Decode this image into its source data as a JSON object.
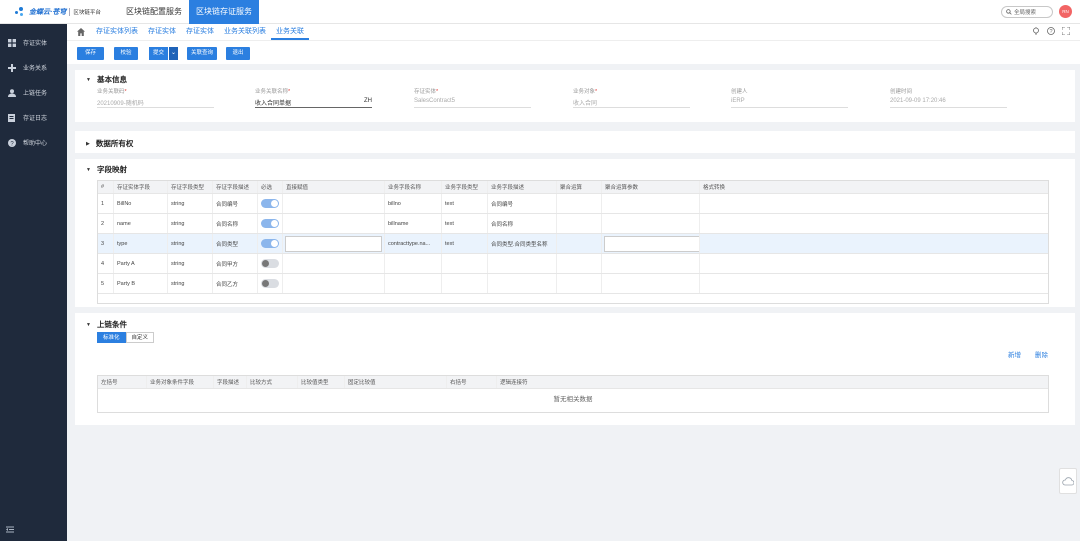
{
  "topbar": {
    "logo_text": "金蝶云·苍穹",
    "logo_platform": "区块链平台",
    "nav": [
      "区块链配置服务",
      "区块链存证服务"
    ],
    "search_placeholder": "全局搜索",
    "avatar": "RN",
    "accent": "#2b7fe0"
  },
  "sidebar": {
    "items": [
      {
        "label": "存证实体",
        "icon": "grid-icon"
      },
      {
        "label": "业务关系",
        "icon": "puzzle-icon"
      },
      {
        "label": "上链任务",
        "icon": "user-icon"
      },
      {
        "label": "存证日志",
        "icon": "doc-icon"
      },
      {
        "label": "帮助中心",
        "icon": "help-icon"
      }
    ]
  },
  "tabs": [
    "存证实体列表",
    "存证实体",
    "存证实体",
    "业务关联列表",
    "业务关联"
  ],
  "toolbar": {
    "save": "保存",
    "check": "校验",
    "submit": "提交",
    "related": "关联查询",
    "exit": "退出"
  },
  "basic": {
    "title": "基本信息",
    "fields": [
      {
        "label": "业务关联码",
        "required": true,
        "value": "20210909-随机码"
      },
      {
        "label": "业务关联名称",
        "required": true,
        "value": "收入合同单据",
        "suffix": "ZH"
      },
      {
        "label": "存证实体",
        "required": true,
        "value": "SalesContract5"
      },
      {
        "label": "业务对象",
        "required": true,
        "value": "收入合同"
      },
      {
        "label": "创建人",
        "required": false,
        "value": "iERP"
      },
      {
        "label": "创建时间",
        "required": false,
        "value": "2021-09-09 17:20:46"
      }
    ]
  },
  "ownership": {
    "title": "数据所有权"
  },
  "mapping": {
    "title": "字段映射",
    "headers": [
      "#",
      "存证实体字段",
      "存证字段类型",
      "存证字段描述",
      "必选",
      "直接赋值",
      "业务字段名称",
      "业务字段类型",
      "业务字段描述",
      "聚合运算",
      "聚合运算参数",
      "格式转换"
    ],
    "rows": [
      {
        "n": "1",
        "f": "BillNo",
        "t": "string",
        "d": "合同编号",
        "req": true,
        "bf": "billno",
        "bt": "text",
        "bd": "合同编号"
      },
      {
        "n": "2",
        "f": "name",
        "t": "string",
        "d": "合同名称",
        "req": true,
        "bf": "billname",
        "bt": "text",
        "bd": "合同名称"
      },
      {
        "n": "3",
        "f": "type",
        "t": "string",
        "d": "合同类型",
        "req": true,
        "bf": "contracttype.na...",
        "bt": "text",
        "bd": "合同类型.合同类型名称"
      },
      {
        "n": "4",
        "f": "Party A",
        "t": "string",
        "d": "合同甲方",
        "req": false,
        "bf": "",
        "bt": "",
        "bd": ""
      },
      {
        "n": "5",
        "f": "Party B",
        "t": "string",
        "d": "合同乙方",
        "req": false,
        "bf": "",
        "bt": "",
        "bd": ""
      }
    ]
  },
  "chain": {
    "title": "上链条件",
    "tabs": [
      "标准化",
      "自定义"
    ],
    "add": "新增",
    "delete": "删除",
    "headers": [
      "左括号",
      "业务对象条件字段",
      "字段描述",
      "比较方式",
      "比较值类型",
      "固定比较值",
      "右括号",
      "逻辑连接符"
    ],
    "empty": "暂无相关数据"
  }
}
